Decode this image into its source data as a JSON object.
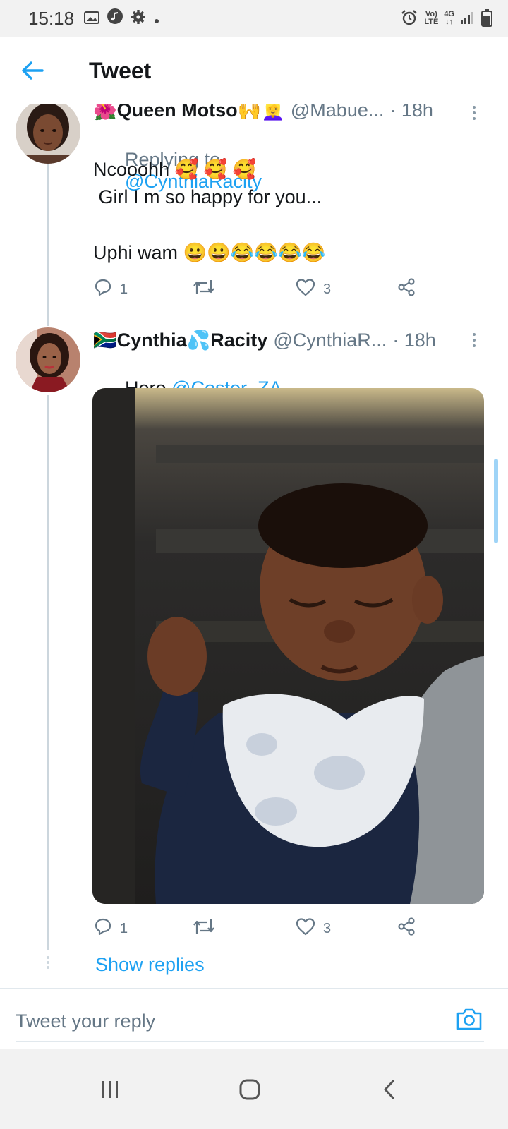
{
  "status_bar": {
    "time": "15:18",
    "left_icons": [
      "image-icon",
      "music-icon",
      "gear-icon",
      "dot-icon"
    ],
    "network_top": "Vo)",
    "network_bottom": "LTE",
    "data_top": "4G",
    "data_bottom": "↓↑",
    "right_icons": [
      "alarm-icon",
      "signal-icon",
      "battery-icon"
    ]
  },
  "header": {
    "title": "Tweet",
    "back_icon": "back-arrow-icon"
  },
  "tweets": [
    {
      "name_prefix": "🌺",
      "name": "Queen Motso",
      "name_suffix": "🙌👱‍♀️",
      "handle": "@Mabue...",
      "time": "· 18h",
      "replying_label": "Replying to",
      "replying_to": "@CynthiaRacity",
      "lines": [
        "Ncooohh 🥰 🥰 🥰",
        " Girl I m so happy for you...",
        "",
        "Uphi wam 😀😀😂😂😂😂"
      ],
      "replies": "1",
      "likes": "3"
    },
    {
      "name_prefix": "🇿🇦",
      "name": "Cynthia",
      "name_mid": "💦",
      "name_end": "Racity",
      "handle": "@CynthiaR...",
      "time": "· 18h",
      "text_prefix": "Here ",
      "mention": "@Coster_ZA",
      "media_alt": "baby-photo",
      "replies": "1",
      "likes": "3"
    }
  ],
  "show_replies": "Show replies",
  "reply_bar": {
    "placeholder": "Tweet your reply",
    "camera_icon": "camera-icon"
  },
  "nav_bar": {
    "icons": [
      "recent-apps-icon",
      "home-icon",
      "back-icon"
    ]
  },
  "colors": {
    "accent": "#1da1f2",
    "muted": "#657786",
    "text": "#14171a",
    "thread_line": "#ccd6dd"
  }
}
